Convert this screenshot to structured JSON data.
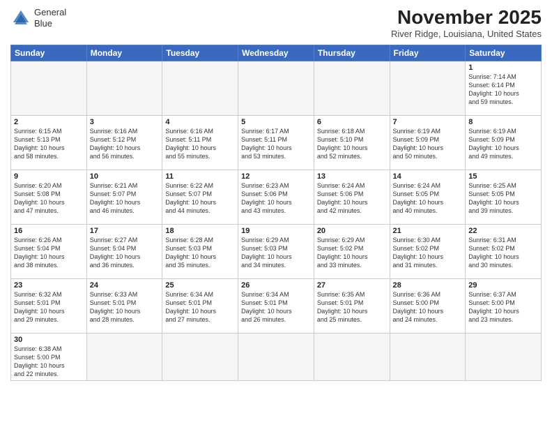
{
  "header": {
    "logo_line1": "General",
    "logo_line2": "Blue",
    "month_title": "November 2025",
    "location": "River Ridge, Louisiana, United States"
  },
  "days_of_week": [
    "Sunday",
    "Monday",
    "Tuesday",
    "Wednesday",
    "Thursday",
    "Friday",
    "Saturday"
  ],
  "weeks": [
    [
      {
        "day": "",
        "info": ""
      },
      {
        "day": "",
        "info": ""
      },
      {
        "day": "",
        "info": ""
      },
      {
        "day": "",
        "info": ""
      },
      {
        "day": "",
        "info": ""
      },
      {
        "day": "",
        "info": ""
      },
      {
        "day": "1",
        "info": "Sunrise: 7:14 AM\nSunset: 6:14 PM\nDaylight: 10 hours\nand 59 minutes."
      }
    ],
    [
      {
        "day": "2",
        "info": "Sunrise: 6:15 AM\nSunset: 5:13 PM\nDaylight: 10 hours\nand 58 minutes."
      },
      {
        "day": "3",
        "info": "Sunrise: 6:16 AM\nSunset: 5:12 PM\nDaylight: 10 hours\nand 56 minutes."
      },
      {
        "day": "4",
        "info": "Sunrise: 6:16 AM\nSunset: 5:11 PM\nDaylight: 10 hours\nand 55 minutes."
      },
      {
        "day": "5",
        "info": "Sunrise: 6:17 AM\nSunset: 5:11 PM\nDaylight: 10 hours\nand 53 minutes."
      },
      {
        "day": "6",
        "info": "Sunrise: 6:18 AM\nSunset: 5:10 PM\nDaylight: 10 hours\nand 52 minutes."
      },
      {
        "day": "7",
        "info": "Sunrise: 6:19 AM\nSunset: 5:09 PM\nDaylight: 10 hours\nand 50 minutes."
      },
      {
        "day": "8",
        "info": "Sunrise: 6:19 AM\nSunset: 5:09 PM\nDaylight: 10 hours\nand 49 minutes."
      }
    ],
    [
      {
        "day": "9",
        "info": "Sunrise: 6:20 AM\nSunset: 5:08 PM\nDaylight: 10 hours\nand 47 minutes."
      },
      {
        "day": "10",
        "info": "Sunrise: 6:21 AM\nSunset: 5:07 PM\nDaylight: 10 hours\nand 46 minutes."
      },
      {
        "day": "11",
        "info": "Sunrise: 6:22 AM\nSunset: 5:07 PM\nDaylight: 10 hours\nand 44 minutes."
      },
      {
        "day": "12",
        "info": "Sunrise: 6:23 AM\nSunset: 5:06 PM\nDaylight: 10 hours\nand 43 minutes."
      },
      {
        "day": "13",
        "info": "Sunrise: 6:24 AM\nSunset: 5:06 PM\nDaylight: 10 hours\nand 42 minutes."
      },
      {
        "day": "14",
        "info": "Sunrise: 6:24 AM\nSunset: 5:05 PM\nDaylight: 10 hours\nand 40 minutes."
      },
      {
        "day": "15",
        "info": "Sunrise: 6:25 AM\nSunset: 5:05 PM\nDaylight: 10 hours\nand 39 minutes."
      }
    ],
    [
      {
        "day": "16",
        "info": "Sunrise: 6:26 AM\nSunset: 5:04 PM\nDaylight: 10 hours\nand 38 minutes."
      },
      {
        "day": "17",
        "info": "Sunrise: 6:27 AM\nSunset: 5:04 PM\nDaylight: 10 hours\nand 36 minutes."
      },
      {
        "day": "18",
        "info": "Sunrise: 6:28 AM\nSunset: 5:03 PM\nDaylight: 10 hours\nand 35 minutes."
      },
      {
        "day": "19",
        "info": "Sunrise: 6:29 AM\nSunset: 5:03 PM\nDaylight: 10 hours\nand 34 minutes."
      },
      {
        "day": "20",
        "info": "Sunrise: 6:29 AM\nSunset: 5:02 PM\nDaylight: 10 hours\nand 33 minutes."
      },
      {
        "day": "21",
        "info": "Sunrise: 6:30 AM\nSunset: 5:02 PM\nDaylight: 10 hours\nand 31 minutes."
      },
      {
        "day": "22",
        "info": "Sunrise: 6:31 AM\nSunset: 5:02 PM\nDaylight: 10 hours\nand 30 minutes."
      }
    ],
    [
      {
        "day": "23",
        "info": "Sunrise: 6:32 AM\nSunset: 5:01 PM\nDaylight: 10 hours\nand 29 minutes."
      },
      {
        "day": "24",
        "info": "Sunrise: 6:33 AM\nSunset: 5:01 PM\nDaylight: 10 hours\nand 28 minutes."
      },
      {
        "day": "25",
        "info": "Sunrise: 6:34 AM\nSunset: 5:01 PM\nDaylight: 10 hours\nand 27 minutes."
      },
      {
        "day": "26",
        "info": "Sunrise: 6:34 AM\nSunset: 5:01 PM\nDaylight: 10 hours\nand 26 minutes."
      },
      {
        "day": "27",
        "info": "Sunrise: 6:35 AM\nSunset: 5:01 PM\nDaylight: 10 hours\nand 25 minutes."
      },
      {
        "day": "28",
        "info": "Sunrise: 6:36 AM\nSunset: 5:00 PM\nDaylight: 10 hours\nand 24 minutes."
      },
      {
        "day": "29",
        "info": "Sunrise: 6:37 AM\nSunset: 5:00 PM\nDaylight: 10 hours\nand 23 minutes."
      }
    ],
    [
      {
        "day": "30",
        "info": "Sunrise: 6:38 AM\nSunset: 5:00 PM\nDaylight: 10 hours\nand 22 minutes."
      },
      {
        "day": "",
        "info": ""
      },
      {
        "day": "",
        "info": ""
      },
      {
        "day": "",
        "info": ""
      },
      {
        "day": "",
        "info": ""
      },
      {
        "day": "",
        "info": ""
      },
      {
        "day": "",
        "info": ""
      }
    ]
  ]
}
